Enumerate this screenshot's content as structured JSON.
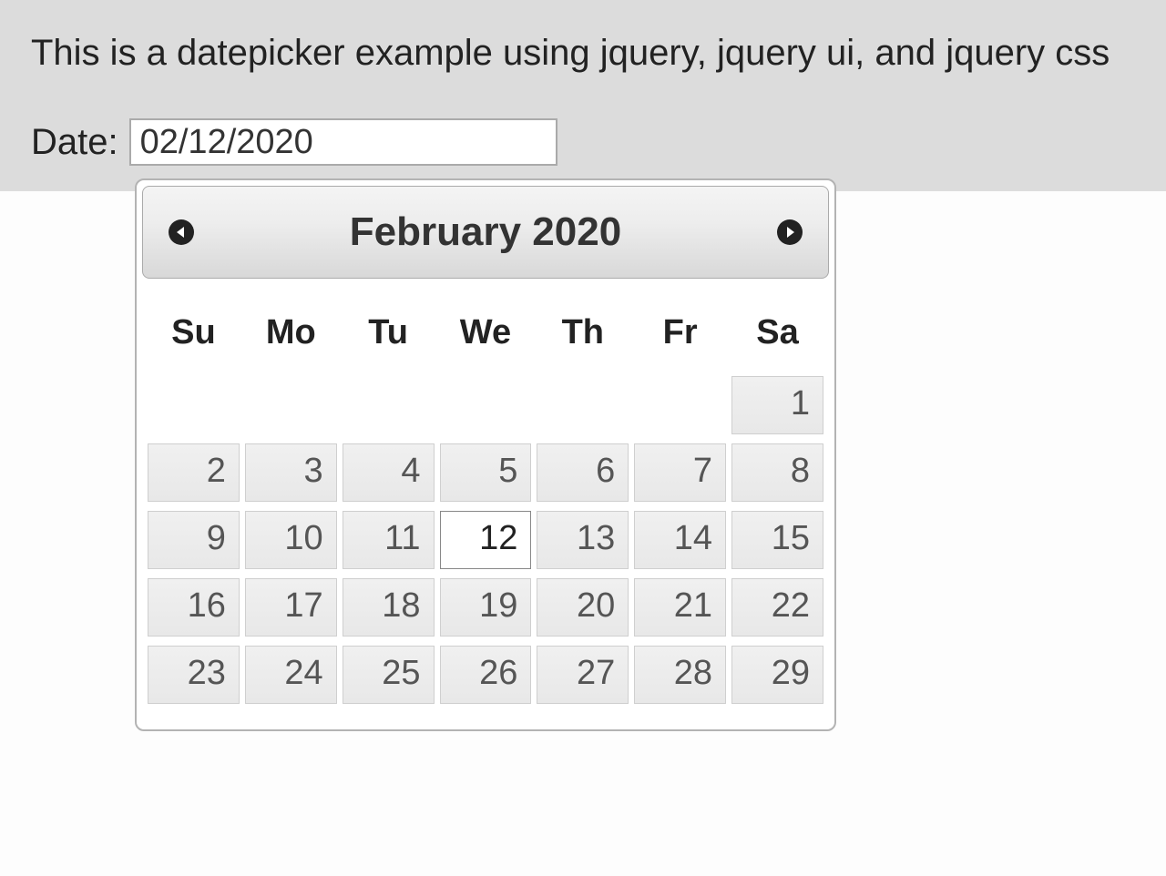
{
  "page": {
    "heading": "This is a datepicker example using jquery, jquery ui, and jquery css",
    "date_label": "Date:",
    "date_value": "02/12/2020"
  },
  "datepicker": {
    "title": "February 2020",
    "weekdays": [
      "Su",
      "Mo",
      "Tu",
      "We",
      "Th",
      "Fr",
      "Sa"
    ],
    "selected_day": 12,
    "weeks": [
      [
        null,
        null,
        null,
        null,
        null,
        null,
        1
      ],
      [
        2,
        3,
        4,
        5,
        6,
        7,
        8
      ],
      [
        9,
        10,
        11,
        12,
        13,
        14,
        15
      ],
      [
        16,
        17,
        18,
        19,
        20,
        21,
        22
      ],
      [
        23,
        24,
        25,
        26,
        27,
        28,
        29
      ]
    ]
  }
}
